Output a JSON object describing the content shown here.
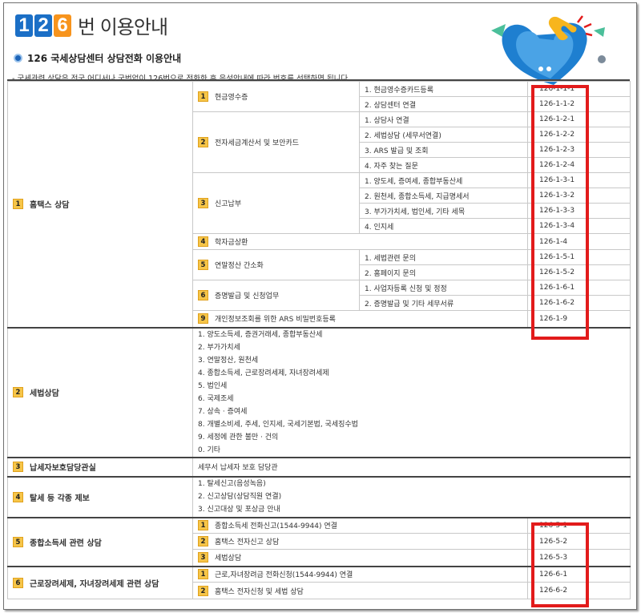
{
  "header": {
    "logo_digits": [
      "1",
      "2",
      "6"
    ],
    "title": "번 이용안내",
    "subtitle": "126 국세상담센터 상담전화 이용안내",
    "description": "- 국세관련 상담은 전국 어디서나 국번없이 126번으로 전화한 후 음성안내에 따라 번호를 선택하면 됩니다."
  },
  "colors": {
    "highlight": "#e21b1b",
    "badge": "#f6c548",
    "logo_blue": "#1b6fc6",
    "logo_orange": "#f7941d"
  },
  "sections": [
    {
      "num": "1",
      "label": "홈택스 상담",
      "subs": [
        {
          "num": "1",
          "label": "현금영수증",
          "items": [
            {
              "text": "1. 현금영수증카드등록",
              "code": "126-1-1-1"
            },
            {
              "text": "2. 상담센터 연결",
              "code": "126-1-1-2"
            }
          ]
        },
        {
          "num": "2",
          "label": "전자세금계산서 및 보안카드",
          "items": [
            {
              "text": "1. 상담사 연결",
              "code": "126-1-2-1"
            },
            {
              "text": "2. 세법상담 (세무서연결)",
              "code": "126-1-2-2"
            },
            {
              "text": "3. ARS 발급 및 조회",
              "code": "126-1-2-3"
            },
            {
              "text": "4. 자주 찾는 질문",
              "code": "126-1-2-4"
            }
          ]
        },
        {
          "num": "3",
          "label": "신고납부",
          "items": [
            {
              "text": "1. 양도세, 증여세, 종합부동산세",
              "code": "126-1-3-1"
            },
            {
              "text": "2. 원천세, 종합소득세, 지급명세서",
              "code": "126-1-3-2"
            },
            {
              "text": "3. 부가가치세, 법인세, 기타 세목",
              "code": "126-1-3-3"
            },
            {
              "text": "4. 인지세",
              "code": "126-1-3-4"
            }
          ]
        },
        {
          "num": "4",
          "label": "학자금상환",
          "code": "126-1-4"
        },
        {
          "num": "5",
          "label": "연말정산 간소화",
          "items": [
            {
              "text": "1. 세법관련 문의",
              "code": "126-1-5-1"
            },
            {
              "text": "2. 홈페이지 문의",
              "code": "126-1-5-2"
            }
          ]
        },
        {
          "num": "6",
          "label": "증명발급 및 신청업무",
          "items": [
            {
              "text": "1. 사업자등록 신청 및 정정",
              "code": "126-1-6-1"
            },
            {
              "text": "2. 증명발급 및 기타 세무서류",
              "code": "126-1-6-2"
            }
          ]
        },
        {
          "num": "9",
          "label": "개인정보조회를 위한 ARS 비밀번호등록",
          "code": "126-1-9"
        }
      ]
    },
    {
      "num": "2",
      "label": "세법상담",
      "list": [
        "1. 양도소득세, 증권거래세, 종합부동산세",
        "2. 부가가치세",
        "3. 연말정산, 원천세",
        "4. 종합소득세, 근로장려세제, 자녀장려세제",
        "5. 법인세",
        "6. 국제조세",
        "7. 상속 · 증여세",
        "8. 개별소비세, 주세, 인지세, 국세기본법, 국세징수법",
        "9. 세정에 관한 불만 · 건의",
        "0. 기타"
      ]
    },
    {
      "num": "3",
      "label": "납세자보호담당관실",
      "text": "세무서 납세자 보호 담당관"
    },
    {
      "num": "4",
      "label": "탈세 등 각종 제보",
      "list": [
        "1. 탈세신고(음성녹음)",
        "2. 신고상담(상담직원 연결)",
        "3. 신고대상 및 포상금 안내"
      ]
    },
    {
      "num": "5",
      "label": "종합소득세 관련 상담",
      "subs": [
        {
          "num": "1",
          "label": "종합소득세 전화신고(1544-9944) 연결",
          "code": "126-5-1"
        },
        {
          "num": "2",
          "label": "홈택스 전자신고 상담",
          "code": "126-5-2"
        },
        {
          "num": "3",
          "label": "세법상담",
          "code": "126-5-3"
        }
      ]
    },
    {
      "num": "6",
      "label": "근로장려세제, 자녀장려세제 관련 상담",
      "subs": [
        {
          "num": "1",
          "label": "근로,자녀장려금 전화신청(1544-9944) 연결",
          "code": "126-6-1"
        },
        {
          "num": "2",
          "label": "홈택스 전자신청 및 세법 상담",
          "code": "126-6-2"
        }
      ]
    }
  ]
}
